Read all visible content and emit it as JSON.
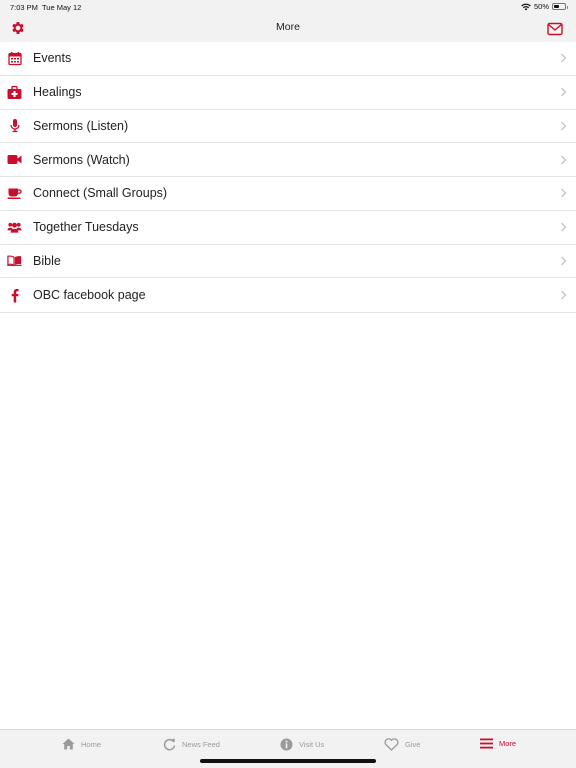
{
  "status_bar": {
    "time": "7:03 PM",
    "date": "Tue May 12",
    "battery": "50%"
  },
  "nav": {
    "title": "More",
    "settings_icon": "gear-icon",
    "mail_icon": "envelope-icon"
  },
  "accent_color": "#c8102e",
  "menu_items": [
    {
      "label": "Events",
      "icon": "calendar-icon"
    },
    {
      "label": "Healings",
      "icon": "first-aid-kit-icon"
    },
    {
      "label": "Sermons (Listen)",
      "icon": "microphone-icon"
    },
    {
      "label": "Sermons (Watch)",
      "icon": "video-camera-icon"
    },
    {
      "label": "Connect (Small Groups)",
      "icon": "coffee-cup-icon"
    },
    {
      "label": "Together Tuesdays",
      "icon": "group-icon"
    },
    {
      "label": "Bible",
      "icon": "open-book-icon"
    },
    {
      "label": "OBC facebook page",
      "icon": "facebook-icon"
    }
  ],
  "tabs": [
    {
      "label": "Home",
      "icon": "home-icon",
      "active": false
    },
    {
      "label": "News Feed",
      "icon": "refresh-icon",
      "active": false
    },
    {
      "label": "Visit Us",
      "icon": "info-icon",
      "active": false
    },
    {
      "label": "Give",
      "icon": "heart-icon",
      "active": false
    },
    {
      "label": "More",
      "icon": "menu-icon",
      "active": true
    }
  ]
}
